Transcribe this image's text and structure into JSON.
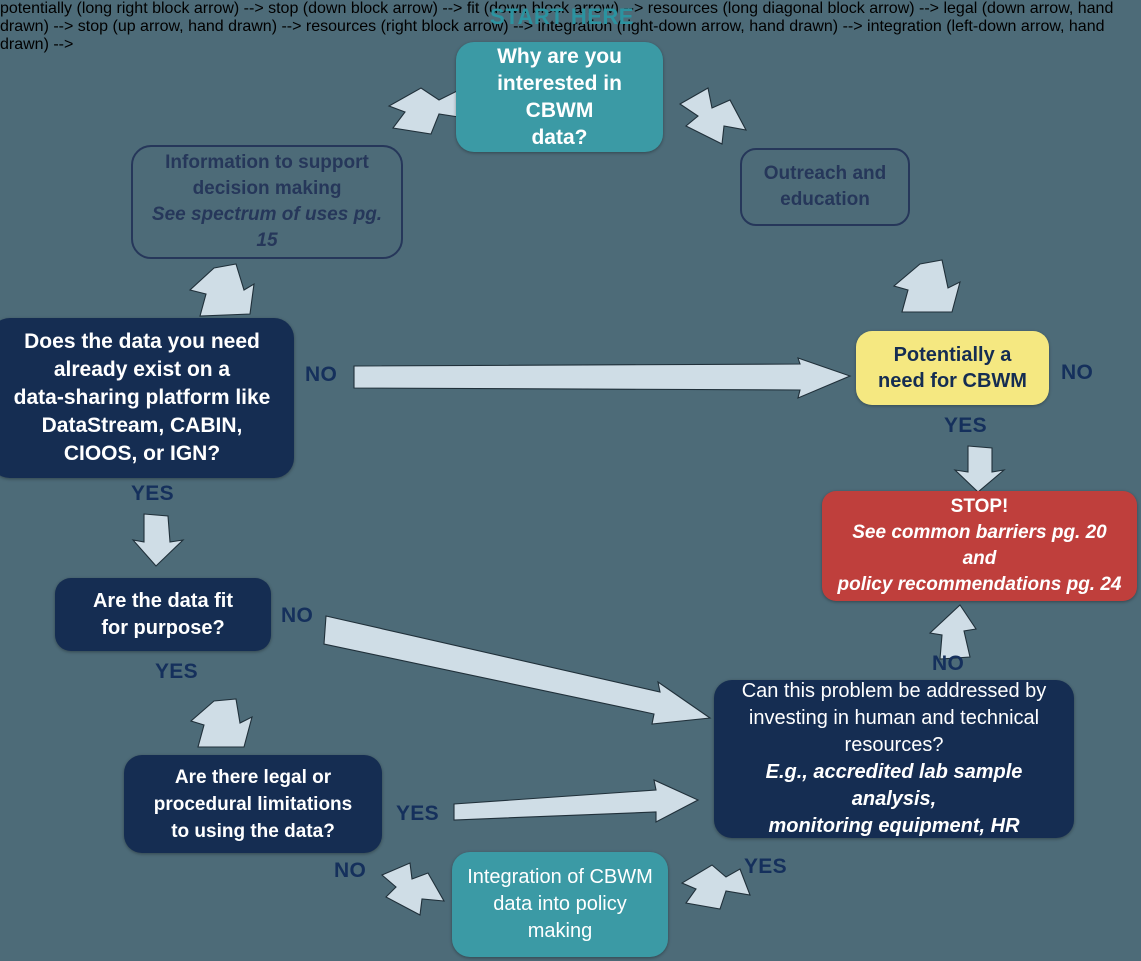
{
  "diagram": {
    "title_label": "START HERE",
    "background_color": "#4d6b78",
    "palette": {
      "teal": "#3b9aa5",
      "navy": "#152d52",
      "outline": "#26375a",
      "yellow": "#f5e881",
      "red": "#bf3f3c",
      "arrow": "#cfdde6",
      "label_text": "#15305c",
      "start_label": "#2b93a0"
    },
    "nodes": {
      "why": {
        "line1": "Why are you",
        "line2": "interested in CBWM",
        "line3": "data?"
      },
      "info": {
        "line1": "Information to support",
        "line2": "decision making",
        "note": "See spectrum of uses pg. 15"
      },
      "outreach": {
        "line1": "Outreach and",
        "line2": "education"
      },
      "exist": {
        "line1": "Does the data you need",
        "line2": "already exist on a",
        "line3": "data-sharing platform like",
        "line4": "DataStream, CABIN,",
        "line5": "CIOOS, or IGN?"
      },
      "potential": {
        "line1": "Potentially a",
        "line2": "need for CBWM"
      },
      "stop": {
        "heading": "STOP!",
        "note1": "See common barriers pg. 20 and",
        "note2": "policy recommendations pg. 24"
      },
      "fit": {
        "line1": "Are the data fit",
        "line2": "for purpose?"
      },
      "legal": {
        "line1": "Are there legal or",
        "line2": "procedural limitations",
        "line3": "to using the data?"
      },
      "resources": {
        "line1": "Can this problem be addressed by",
        "line2": "investing in human and technical",
        "line3": "resources?",
        "note1": "E.g., accredited lab sample analysis,",
        "note2": "monitoring equipment, HR"
      },
      "integration": {
        "line1": "Integration of CBWM",
        "line2": "data into policy",
        "line3": "making"
      }
    },
    "edge_labels": {
      "no_exist_to_potential": "NO",
      "no_potential_right": "NO",
      "yes_potential_to_stop": "YES",
      "yes_exist_to_fit": "YES",
      "no_fit_to_resources": "NO",
      "yes_fit_to_legal": "YES",
      "no_resources_to_stop": "NO",
      "yes_legal_to_resources": "YES",
      "no_legal_to_integration": "NO",
      "yes_resources_to_integration": "YES"
    },
    "icons": {
      "arrow_down_left": "arrow-down-left-icon",
      "arrow_down_right": "arrow-down-right-icon",
      "arrow_down": "arrow-down-icon",
      "arrow_up": "arrow-up-icon",
      "arrow_right": "arrow-right-icon"
    }
  }
}
